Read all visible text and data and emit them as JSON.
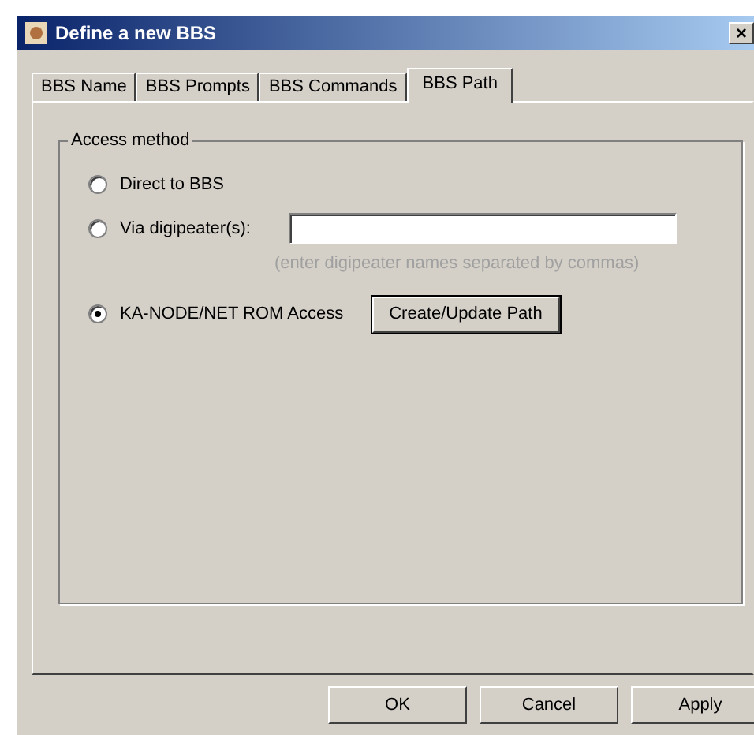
{
  "window": {
    "title": "Define a new BBS",
    "close": "×"
  },
  "tabs": [
    {
      "label": "BBS Name",
      "selected": false
    },
    {
      "label": "BBS Prompts",
      "selected": false
    },
    {
      "label": "BBS Commands",
      "selected": false
    },
    {
      "label": "BBS Path",
      "selected": true
    }
  ],
  "group": {
    "title": "Access method",
    "options": [
      {
        "kind": "plain",
        "label": "Direct to BBS",
        "selected": false
      },
      {
        "kind": "field",
        "label": "Via digipeater(s):",
        "selected": false,
        "hint": "(enter digipeater names separated by commas)"
      },
      {
        "kind": "button",
        "label": "KA-NODE/NET ROM Access",
        "selected": true,
        "button": "Create/Update Path"
      }
    ]
  },
  "buttons": [
    "OK",
    "Cancel",
    "Apply"
  ]
}
